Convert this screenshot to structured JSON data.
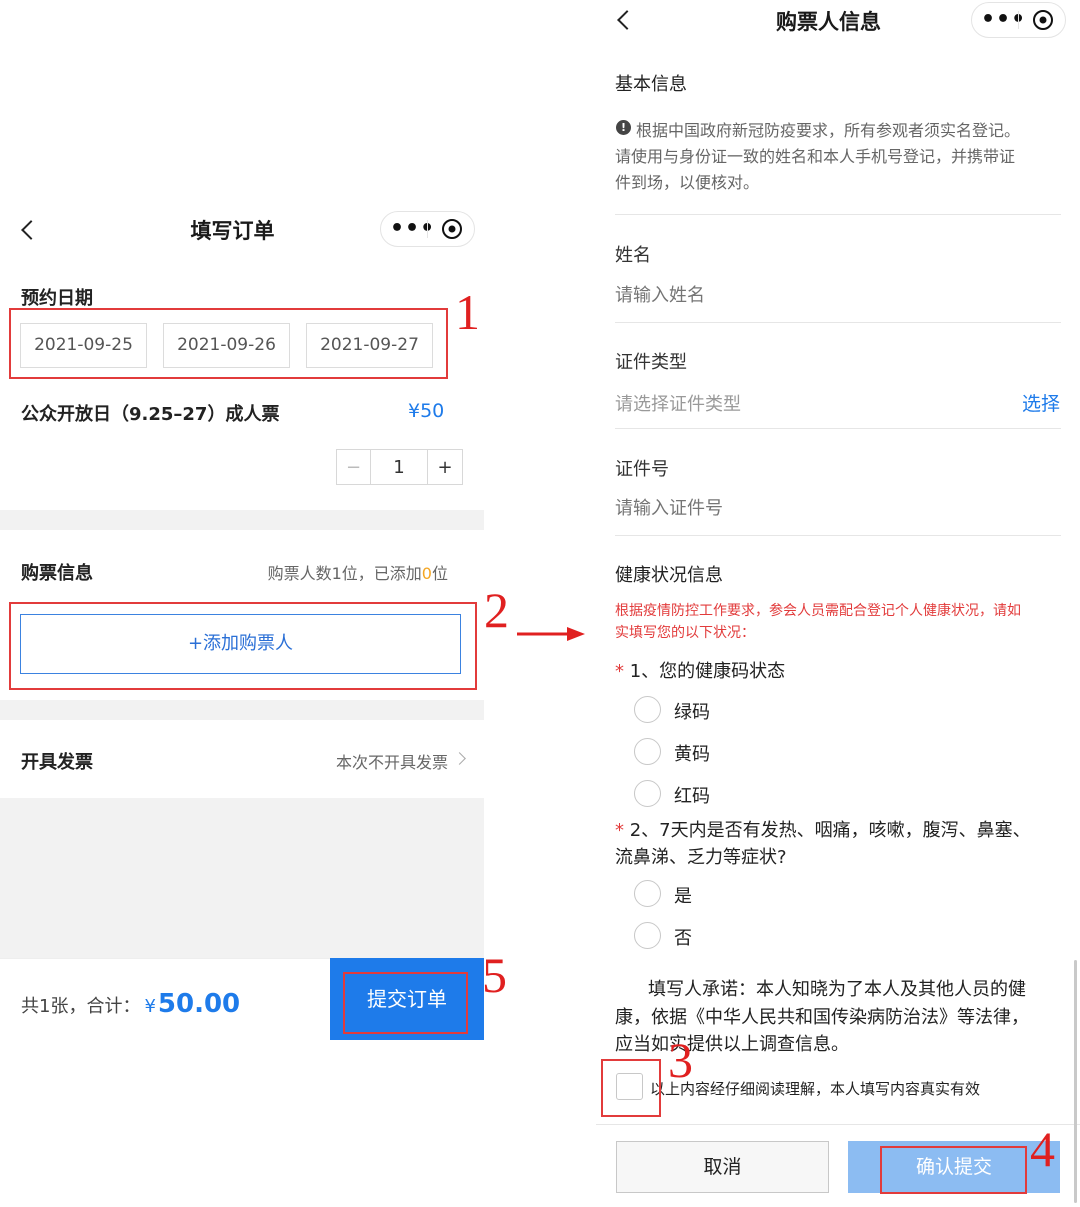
{
  "left": {
    "nav": {
      "title": "填写订单",
      "more_icon": "more-dots-icon",
      "close_icon": "target-circle-icon",
      "back_icon": "chevron-left-icon"
    },
    "booking_date": {
      "label": "预约日期",
      "dates": [
        "2021-09-25",
        "2021-09-26",
        "2021-09-27"
      ]
    },
    "ticket": {
      "name": "公众开放日（9.25–27）成人票",
      "price": "¥50"
    },
    "stepper": {
      "minus": "−",
      "quantity": "1",
      "plus": "+"
    },
    "buyer_info": {
      "label": "购票信息",
      "summary_prefix": "购票人数1位，已添加",
      "added_count": "0",
      "summary_suffix": "位",
      "add_button": "+添加购票人"
    },
    "invoice": {
      "label": "开具发票",
      "value": "本次不开具发票"
    },
    "footer": {
      "count_text": "共1张，合计：",
      "currency": "¥",
      "total": "50.00",
      "submit_label": "提交订单"
    }
  },
  "right": {
    "nav": {
      "title": "购票人信息",
      "more_icon": "more-dots-icon",
      "close_icon": "target-circle-icon",
      "back_icon": "chevron-left-icon"
    },
    "basic_info": {
      "label": "基本信息",
      "notice_lines": [
        "根据中国政府新冠防疫要求，所有参观者须实名登记。",
        "请使用与身份证一致的姓名和本人手机号登记，并携带证",
        "件到场，以便核对。"
      ]
    },
    "fields": {
      "name": {
        "label": "姓名",
        "placeholder": "请输入姓名"
      },
      "id_type": {
        "label": "证件类型",
        "placeholder": "请选择证件类型",
        "action": "选择"
      },
      "id_number": {
        "label": "证件号",
        "placeholder": "请输入证件号"
      }
    },
    "health": {
      "label": "健康状况信息",
      "warning_lines": [
        "根据疫情防控工作要求，参会人员需配合登记个人健康状况，请如",
        "实填写您的以下状况："
      ],
      "q1": {
        "required": "*",
        "text": "1、您的健康码状态",
        "options": [
          "绿码",
          "黄码",
          "红码"
        ]
      },
      "q2": {
        "required": "*",
        "text_line1": "2、7天内是否有发热、咽痛，咳嗽，腹泻、鼻塞、",
        "text_line2": "流鼻涕、乏力等症状?",
        "options": [
          "是",
          "否"
        ]
      }
    },
    "pledge": {
      "lines": [
        "填写人承诺：本人知晓为了本人及其他人员的健",
        "康，依据《中华人民共和国传染病防治法》等法律，",
        "应当如实提供以上调查信息。"
      ],
      "agree_text": "以上内容经仔细阅读理解，本人填写内容真实有效"
    },
    "buttons": {
      "cancel": "取消",
      "confirm": "确认提交"
    }
  },
  "annotations": [
    "1",
    "2",
    "3",
    "4",
    "5"
  ],
  "colors": {
    "accent": "#1e7bea",
    "annotation_red": "#e02020",
    "warning_red": "#e23b3b",
    "price_blue": "#1e7bea",
    "added_orange": "#f5a623"
  }
}
